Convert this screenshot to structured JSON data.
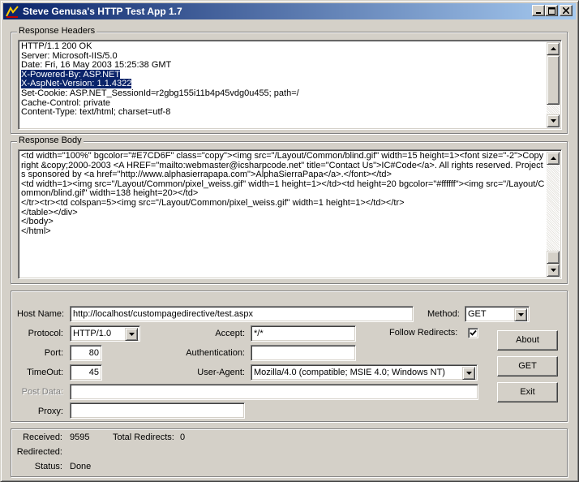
{
  "window": {
    "title": "Steve Genusa's  HTTP Test App 1.7"
  },
  "response_headers": {
    "label": "Response Headers",
    "lines": [
      {
        "text": "HTTP/1.1 200 OK",
        "selected": false
      },
      {
        "text": "Server: Microsoft-IIS/5.0",
        "selected": false
      },
      {
        "text": "Date: Fri, 16 May 2003 15:25:38 GMT",
        "selected": false
      },
      {
        "text": "X-Powered-By: ASP.NET",
        "selected": true
      },
      {
        "text": "X-AspNet-Version: 1.1.4322",
        "selected": true
      },
      {
        "text": "Set-Cookie: ASP.NET_SessionId=r2gbg155i11b4p45vdg0u455; path=/",
        "selected": false
      },
      {
        "text": "Cache-Control: private",
        "selected": false
      },
      {
        "text": "Content-Type: text/html; charset=utf-8",
        "selected": false
      }
    ]
  },
  "response_body": {
    "label": "Response Body",
    "lines": [
      "<td width=\"100%\" bgcolor=\"#E7CD6F\" class=\"copy\"><img src=\"/Layout/Common/blind.gif\" width=15 height=1><font size=\"-2\">Copyright &copy;2000-2003 <A HREF=\"mailto:webmaster@icsharpcode.net\" title=\"Contact Us\">IC#Code</a>. All rights reserved. Projects sponsored by <a href=\"http://www.alphasierrapapa.com\">AlphaSierraPapa</a>.</font></td>",
      "<td width=1><img src=\"/Layout/Common/pixel_weiss.gif\" width=1 height=1></td><td height=20 bgcolor=\"#ffffff\"><img src=\"/Layout/Common/blind.gif\" width=138 height=20></td>",
      "</tr><tr><td colspan=5><img src=\"/Layout/Common/pixel_weiss.gif\" width=1 height=1></td></tr>",
      "</table></div>",
      "</body>",
      "</html>"
    ]
  },
  "request": {
    "host_label": "Host Name:",
    "host_value": "http://localhost/custompagedirective/test.aspx",
    "method_label": "Method:",
    "method_value": "GET",
    "protocol_label": "Protocol:",
    "protocol_value": "HTTP/1.0",
    "accept_label": "Accept:",
    "accept_value": "*/*",
    "follow_label": "Follow Redirects:",
    "follow_checked": true,
    "port_label": "Port:",
    "port_value": "80",
    "auth_label": "Authentication:",
    "auth_value": "",
    "timeout_label": "TimeOut:",
    "timeout_value": "45",
    "useragent_label": "User-Agent:",
    "useragent_value": "Mozilla/4.0 (compatible; MSIE 4.0; Windows NT)",
    "postdata_label": "Post Data:",
    "postdata_value": "",
    "proxy_label": "Proxy:",
    "proxy_value": ""
  },
  "buttons": {
    "about": "About",
    "get": "GET",
    "exit": "Exit"
  },
  "status": {
    "received_label": "Received:",
    "received_value": "9595",
    "redirects_label": "Total Redirects:",
    "redirects_value": "0",
    "redirected_label": "Redirected:",
    "redirected_value": "",
    "status_label": "Status:",
    "status_value": "Done"
  }
}
